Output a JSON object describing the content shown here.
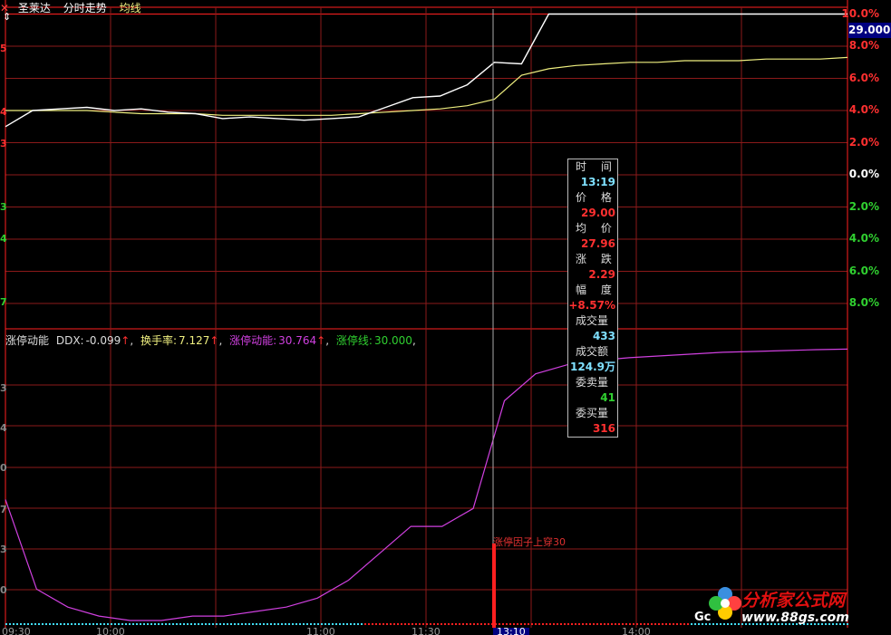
{
  "header": {
    "stock_name": "圣莱达",
    "chart_title": "分时走势",
    "avg_label": "均线"
  },
  "price_axis": {
    "labels_up": [
      "10.0%",
      "8.0%",
      "6.0%",
      "4.0%",
      "2.0%"
    ],
    "label_zero": "0.0%",
    "labels_down": [
      "2.0%",
      "4.0%",
      "6.0%",
      "8.0%"
    ],
    "current_price_box": "29.000",
    "colors": {
      "up": "#ff3030",
      "zero": "#ffffff",
      "down": "#30d030"
    }
  },
  "left_ticks": {
    "upper": [
      "5",
      "4",
      "3"
    ],
    "lower": [
      "3",
      "4",
      "7"
    ],
    "indicator": [
      "3",
      "4",
      "0",
      "7",
      "3",
      "0"
    ]
  },
  "indicator_bar": {
    "name": "涨停动能",
    "ddx_label": "DDX:",
    "ddx_value": "-0.099",
    "turnover_label": "换手率:",
    "turnover_value": "7.127",
    "momentum_label": "涨停动能:",
    "momentum_value": "30.764",
    "limit_label": "涨停线:",
    "limit_value": "30.000",
    "arrow": "↑",
    "comma": ","
  },
  "tooltip": {
    "time_label": "时 间",
    "time_value": "13:19",
    "price_label": "价 格",
    "price_value": "29.00",
    "avg_label": "均 价",
    "avg_value": "27.96",
    "change_label": "涨 跌",
    "change_value": "2.29",
    "range_label": "幅 度",
    "range_value": "+8.57%",
    "volume_label": "成交量",
    "volume_value": "433",
    "amount_label": "成交额",
    "amount_value": "124.9万",
    "sell_label": "委卖量",
    "sell_value": "41",
    "buy_label": "委买量",
    "buy_value": "316"
  },
  "signal_marker": "涨停因子上穿30",
  "logo": {
    "name": "分析家公式网",
    "url": "www.88gs.com",
    "overlay": "Gc"
  },
  "time_axis": {
    "labels": [
      "09:30",
      "10:00",
      "11:00",
      "11:30",
      "13:10",
      "14:00"
    ]
  },
  "colors": {
    "price_line": "#ffffff",
    "avg_line": "#f0f080",
    "momentum_line": "#d040e0",
    "grid": "#8b1a1a",
    "limit_dots": "#40e0ff"
  },
  "chart_data": {
    "type": "line",
    "series": [
      {
        "name": "价格",
        "unit": "%",
        "values": [
          3.0,
          4.0,
          4.1,
          4.2,
          4.0,
          4.1,
          3.9,
          3.8,
          3.5,
          3.6,
          3.5,
          3.4,
          3.5,
          3.6,
          4.2,
          4.8,
          4.9,
          5.6,
          7.0,
          6.9,
          10.0,
          10.0,
          10.0,
          10.0,
          10.0,
          10.0,
          10.0,
          10.0,
          10.0,
          10.0,
          10.0,
          10.0
        ]
      },
      {
        "name": "均线",
        "unit": "%",
        "values": [
          4.0,
          4.0,
          4.0,
          4.0,
          3.9,
          3.8,
          3.8,
          3.8,
          3.7,
          3.7,
          3.7,
          3.7,
          3.7,
          3.8,
          3.9,
          4.0,
          4.1,
          4.3,
          4.7,
          6.2,
          6.6,
          6.8,
          6.9,
          7.0,
          7.0,
          7.1,
          7.1,
          7.1,
          7.2,
          7.2,
          7.2,
          7.3
        ]
      },
      {
        "name": "涨停动能",
        "values": [
          14,
          4,
          2,
          1,
          0.5,
          0.5,
          1,
          1,
          1.5,
          2,
          3,
          5,
          8,
          11,
          11,
          13,
          25,
          28,
          29,
          29.5,
          29.8,
          30.0,
          30.2,
          30.4,
          30.5,
          30.6,
          30.7,
          30.76
        ]
      }
    ]
  }
}
